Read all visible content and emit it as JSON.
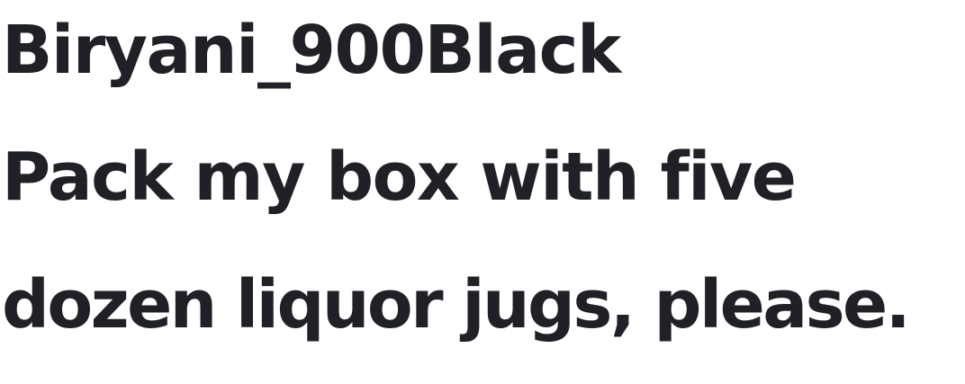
{
  "font_specimen": {
    "font_name": "Biryani_900Black",
    "sample_line_1": "Pack my box with five",
    "sample_line_2": "dozen liquor jugs, please."
  },
  "colors": {
    "text": "#1f2126",
    "background": "#ffffff"
  }
}
